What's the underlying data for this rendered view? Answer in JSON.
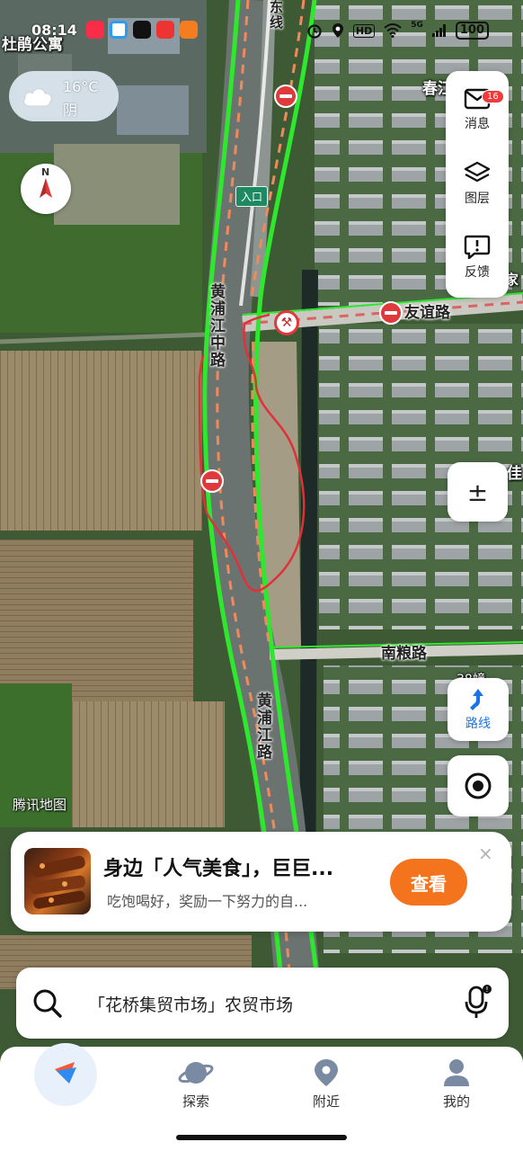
{
  "status_bar": {
    "time": "08:14",
    "battery": "100",
    "network": "5G",
    "hd": "HD"
  },
  "map": {
    "place_labels": [
      "杜鹃公寓",
      "春江佳苑(北",
      "佳",
      "家"
    ],
    "road_labels": {
      "top_road": "东线",
      "huangpu_middle": "黄浦江中路",
      "youyi": "友谊路",
      "nanliang": "南粮路",
      "huangpu": "黄浦江路"
    },
    "entry_tag": "入口",
    "building_label": "38幢",
    "watermark": "腾讯地图"
  },
  "weather": {
    "temperature": "16°C",
    "condition": "阴"
  },
  "toolbar": {
    "messages_label": "消息",
    "messages_badge": "16",
    "layers_label": "图层",
    "feedback_label": "反馈",
    "zoom_symbol": "±",
    "route_label": "路线"
  },
  "promo": {
    "title": "身边「人气美食」，巨巨...",
    "subtitle": "吃饱喝好，奖励一下努力的自...",
    "button": "查看",
    "close": "×"
  },
  "search": {
    "text": "「花桥集贸市场」农贸市场"
  },
  "bottom_nav": {
    "items": [
      {
        "label": "探索"
      },
      {
        "label": "附近"
      },
      {
        "label": "我的"
      }
    ]
  },
  "colors": {
    "accent": "#1a73e8",
    "promo_button": "#f4741e",
    "route_green": "#2ee82e",
    "alert_red": "#e0393b"
  }
}
